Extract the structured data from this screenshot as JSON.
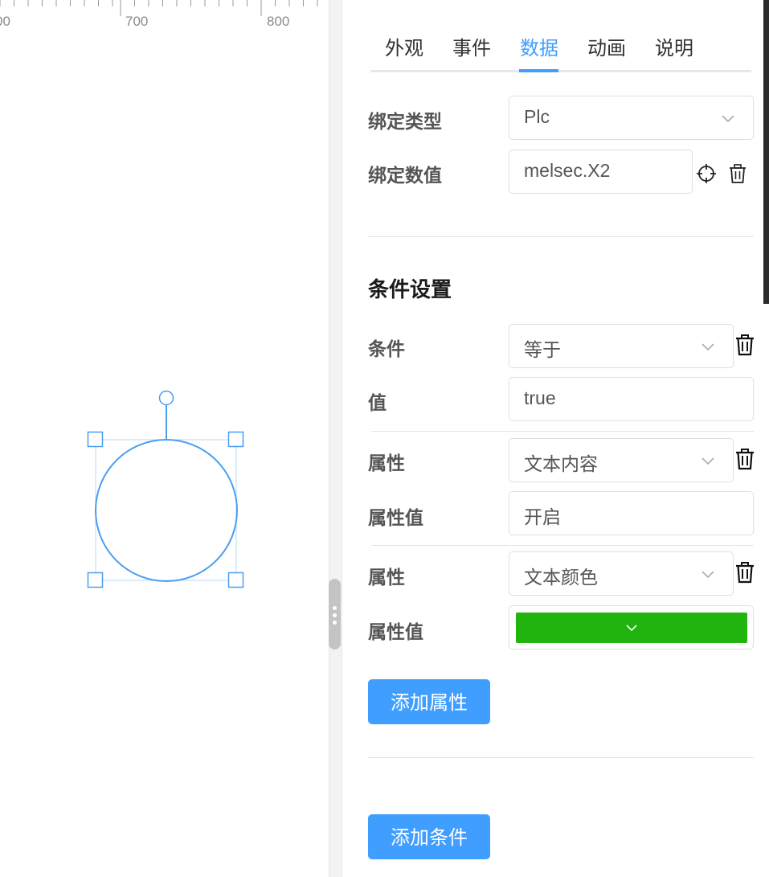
{
  "ruler": {
    "labels": [
      "00",
      "700",
      "800"
    ]
  },
  "tabs": [
    {
      "label": "外观"
    },
    {
      "label": "事件"
    },
    {
      "label": "数据",
      "active": true
    },
    {
      "label": "动画"
    },
    {
      "label": "说明"
    }
  ],
  "binding": {
    "type_label": "绑定类型",
    "type_value": "Plc",
    "value_label": "绑定数值",
    "value_value": "melsec.X2",
    "target_icon": "crosshair-icon",
    "delete_icon": "trash-icon"
  },
  "conditions": {
    "title": "条件设置",
    "condition_label": "条件",
    "condition_value": "等于",
    "value_label": "值",
    "value_value": "true",
    "properties": [
      {
        "attr_label": "属性",
        "attr_value": "文本内容",
        "val_label": "属性值",
        "val_value": "开启"
      },
      {
        "attr_label": "属性",
        "attr_value": "文本颜色",
        "val_label": "属性值",
        "val_color": "#21b40e"
      }
    ],
    "add_property": "添加属性",
    "add_condition": "添加条件"
  },
  "colors": {
    "accent": "#409eff",
    "selection": "#4a9ef0",
    "swatch": "#21b40e"
  }
}
